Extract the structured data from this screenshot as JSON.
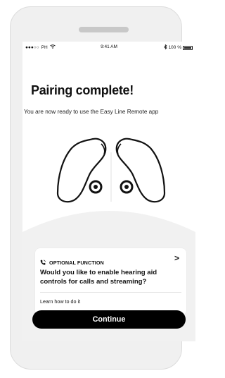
{
  "status_bar": {
    "carrier": "PH",
    "time": "9:41 AM",
    "battery_text": "100 %"
  },
  "header": {
    "title": "Pairing complete!",
    "subtitle": "You are now ready to use the Easy Line Remote app"
  },
  "optional_card": {
    "label": "OPTIONAL FUNCTION",
    "question": "Would you like to enable hearing aid controls for calls and streaming?",
    "link": "Learn how to do it",
    "chevron": ">"
  },
  "actions": {
    "continue_label": "Continue"
  },
  "icons": {
    "phone": "phone-icon",
    "bluetooth": "bluetooth-icon",
    "signal": "signal-icon",
    "wifi": "wifi-icon",
    "battery": "battery-icon"
  }
}
